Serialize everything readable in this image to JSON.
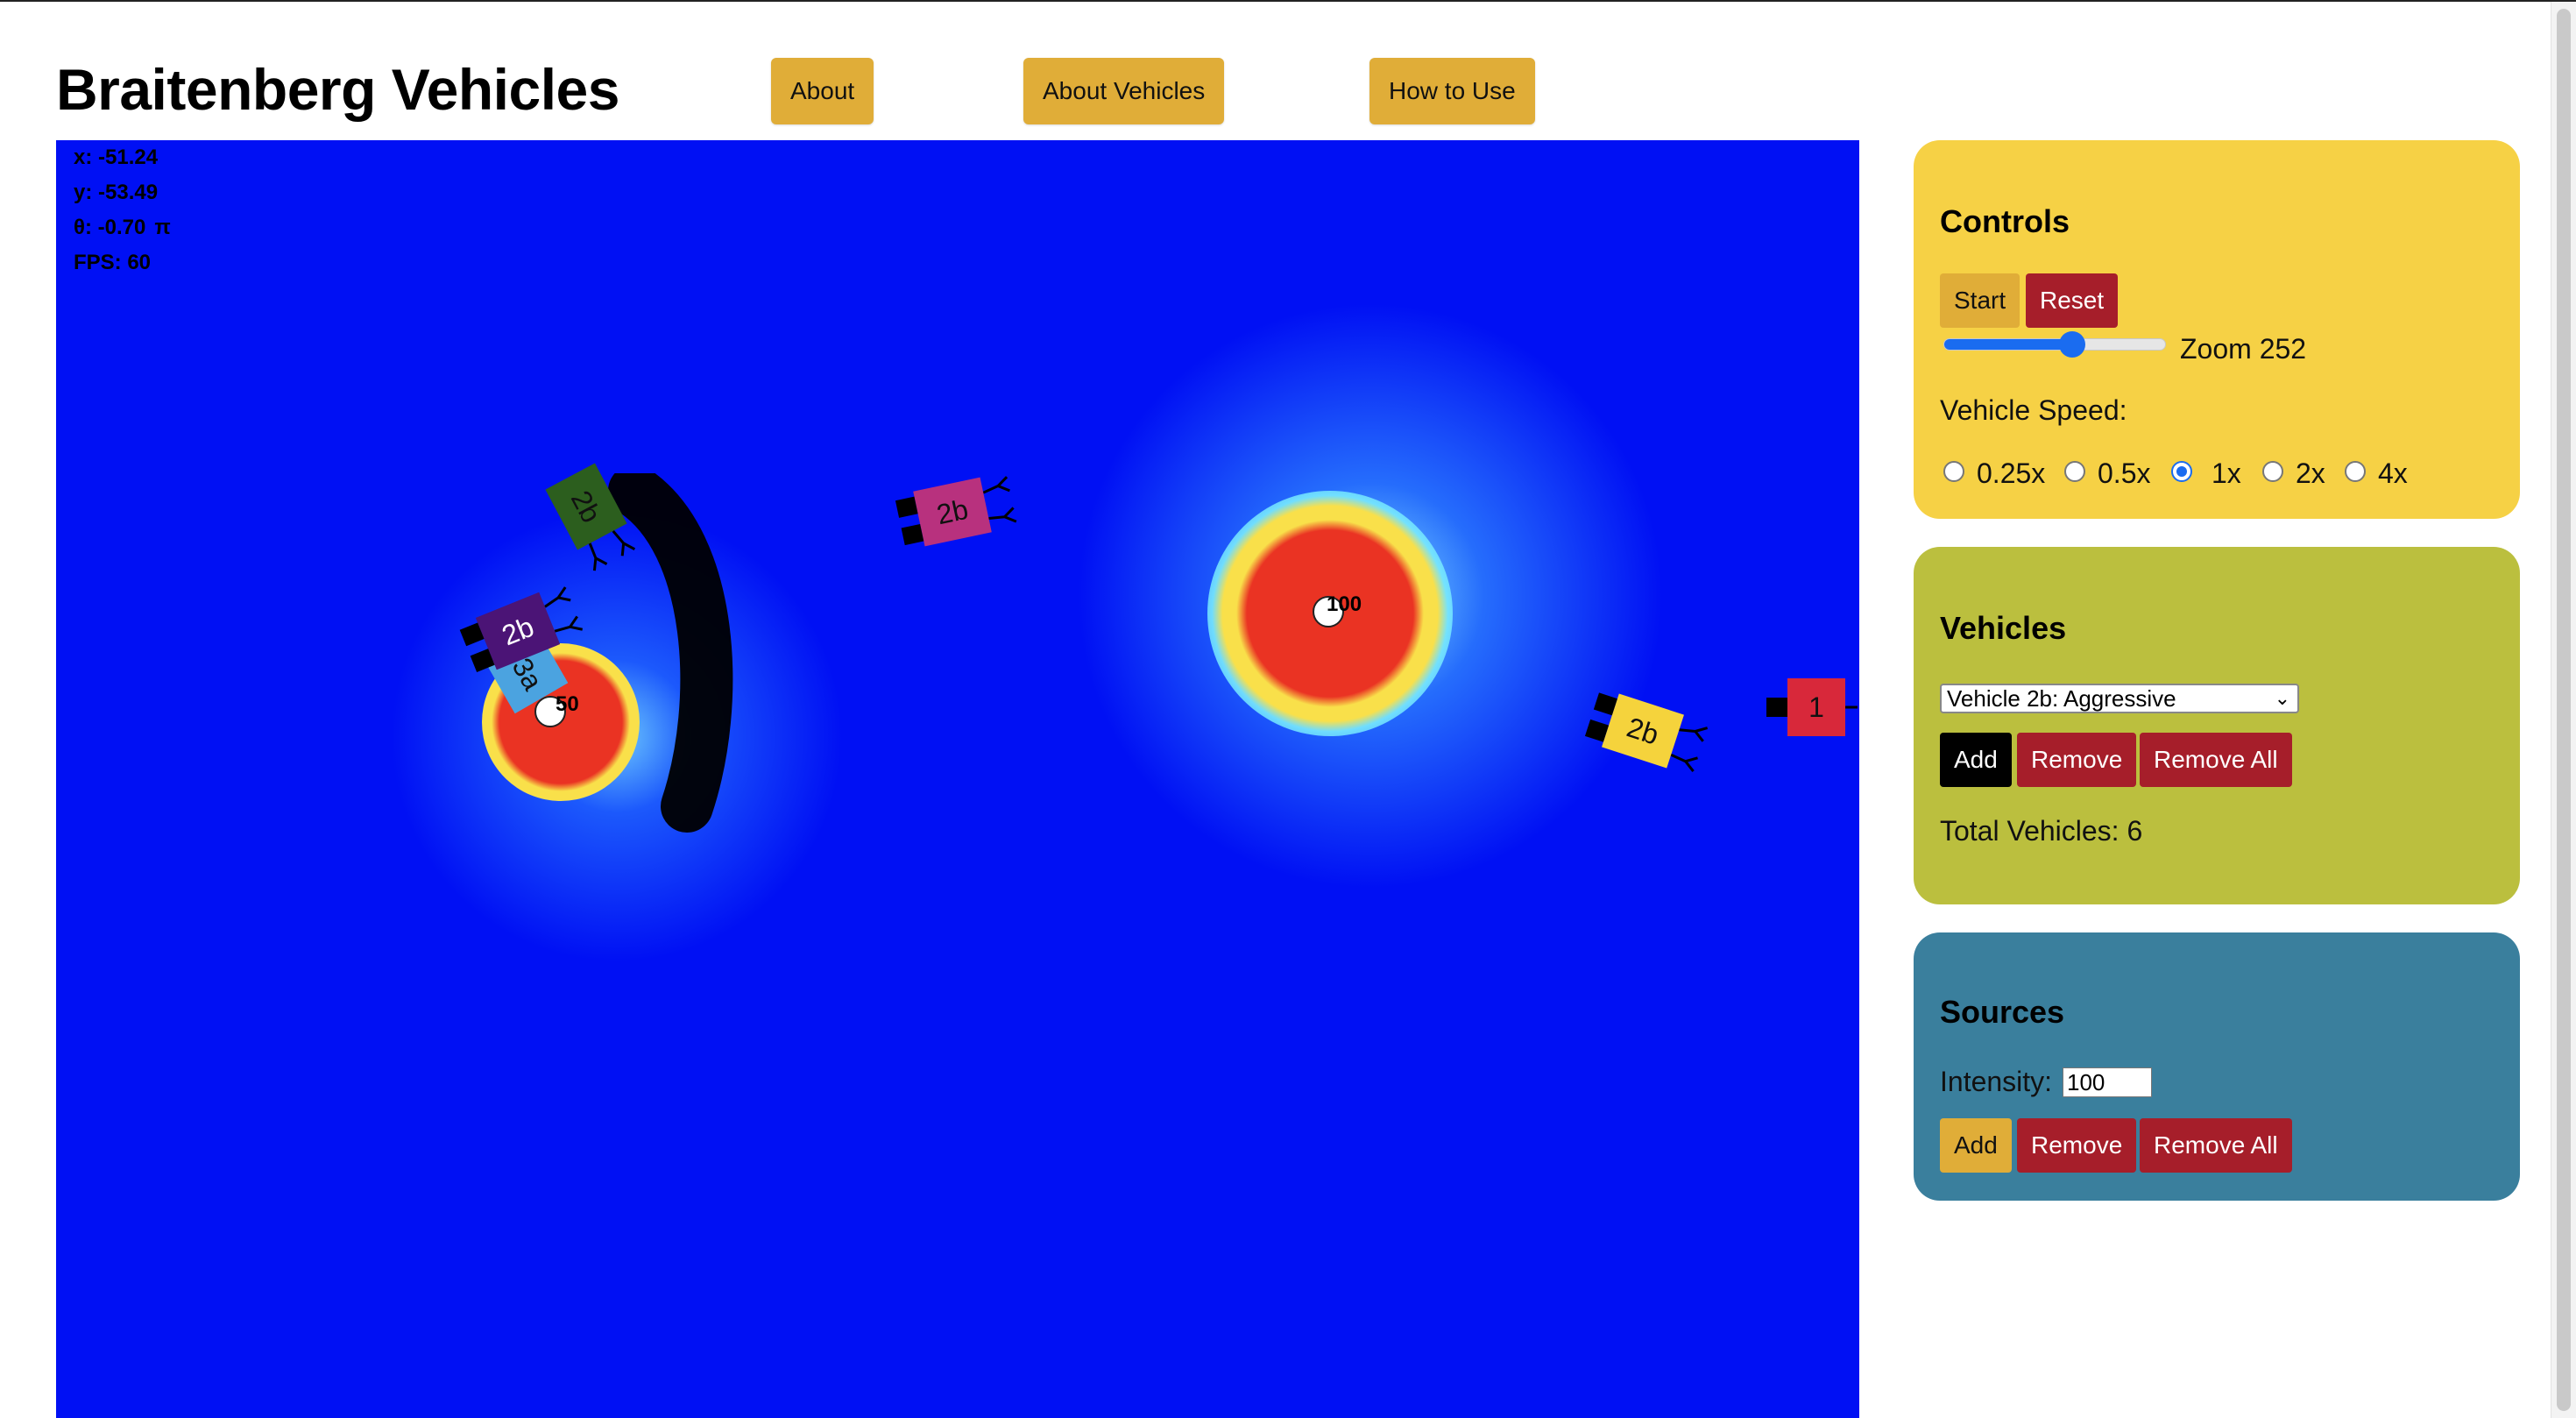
{
  "app": {
    "title": "Braitenberg Vehicles"
  },
  "nav": {
    "about": "About",
    "about_vehicles": "About Vehicles",
    "how_to_use": "How to Use"
  },
  "hud": {
    "x": "x: -51.24",
    "y": "y: -53.49",
    "theta": "θ: -0.70",
    "theta_unit": "π",
    "fps": "FPS: 60"
  },
  "sources": [
    {
      "value": "50"
    },
    {
      "value": "100"
    }
  ],
  "vehicles": [
    {
      "label": "2b",
      "color": "#2c5e1e"
    },
    {
      "label": "2b",
      "color": "#b8317e"
    },
    {
      "label": "2b",
      "color": "#4b1476"
    },
    {
      "label": "3a",
      "color": "#4ba3e0"
    },
    {
      "label": "2b",
      "color": "#f5d33c"
    },
    {
      "label": "1",
      "color": "#d8283a"
    }
  ],
  "controls": {
    "heading": "Controls",
    "start": "Start",
    "reset": "Reset",
    "zoom_label": "Zoom 252",
    "zoom_fraction": 0.58,
    "speed_label": "Vehicle Speed:",
    "speed_options": [
      "0.25x",
      "0.5x",
      "1x",
      "2x",
      "4x"
    ],
    "speed_selected": "1x"
  },
  "vehicles_panel": {
    "heading": "Vehicles",
    "selected_type": "Vehicle 2b: Aggressive",
    "add": "Add",
    "remove": "Remove",
    "remove_all": "Remove All",
    "total": "Total Vehicles: 6"
  },
  "sources_panel": {
    "heading": "Sources",
    "intensity_label": "Intensity:",
    "intensity_value": "100",
    "add": "Add",
    "remove": "Remove",
    "remove_all": "Remove All"
  },
  "colors": {
    "field_background": "#0010f4",
    "controls_panel": "#f6d145",
    "vehicles_panel": "#bbbf3e",
    "sources_panel": "#3a7f9d",
    "button_gold": "#e0ad38",
    "button_red": "#a61e2a",
    "source_core": "#ea3323",
    "source_ring": "#f9e04a"
  },
  "icons": {
    "dropdown": "chevron-down-icon"
  }
}
